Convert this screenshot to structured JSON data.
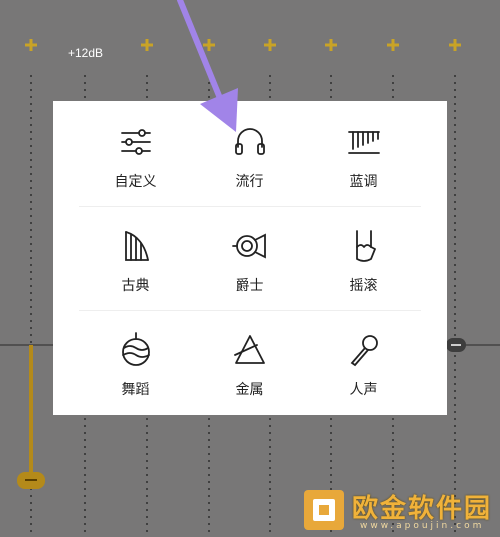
{
  "equalizer": {
    "gain_label": "+12dB",
    "slider_level_fraction": 0.0
  },
  "presets": [
    {
      "label": "自定义",
      "icon": "sliders-icon"
    },
    {
      "label": "流行",
      "icon": "headphones-icon"
    },
    {
      "label": "蓝调",
      "icon": "marimba-icon"
    },
    {
      "label": "古典",
      "icon": "harp-icon"
    },
    {
      "label": "爵士",
      "icon": "french-horn-icon"
    },
    {
      "label": "摇滚",
      "icon": "rock-hand-icon"
    },
    {
      "label": "舞蹈",
      "icon": "disco-ball-icon"
    },
    {
      "label": "金属",
      "icon": "triangle-instrument-icon"
    },
    {
      "label": "人声",
      "icon": "microphone-icon"
    }
  ],
  "annotation": {
    "icon": "purple-arrow-icon",
    "color": "#a184e8"
  },
  "watermark": {
    "brand": "欧金软件园",
    "url": "www.apoujin.com",
    "color": "#f0b23a"
  },
  "colors": {
    "overlay": "#787777",
    "accent": "#d4a82a",
    "panel": "#ffffff"
  }
}
